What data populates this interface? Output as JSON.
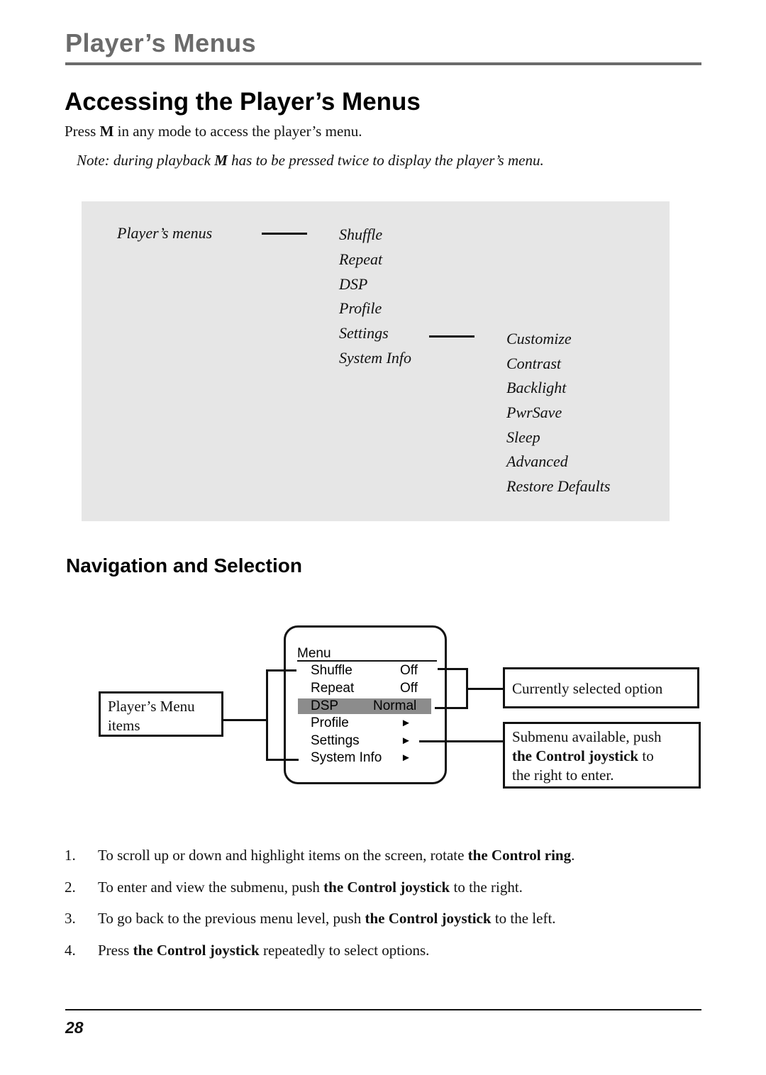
{
  "header": {
    "section_title": "Player’s Menus"
  },
  "accessing": {
    "title": "Accessing the Player’s Menus",
    "intro": {
      "pre": "Press ",
      "key": "M",
      "post": " in any mode to access the player’s menu."
    },
    "note": {
      "pre": "Note: during playback ",
      "key": "M",
      "post": " has to be pressed twice to display the player’s menu."
    }
  },
  "menu_tree": {
    "root": "Player’s menus",
    "level1": [
      "Shuffle",
      "Repeat",
      "DSP",
      "Profile",
      "Settings",
      "System Info"
    ],
    "settings_children": [
      "Customize",
      "Contrast",
      "Backlight",
      "PwrSave",
      "Sleep",
      "Advanced",
      "Restore Defaults"
    ]
  },
  "navigation": {
    "title": "Navigation and Selection",
    "screen": {
      "heading": "Menu",
      "rows": [
        {
          "label": "Shuffle",
          "value": "Off",
          "highlighted": false
        },
        {
          "label": "Repeat",
          "value": "Off",
          "highlighted": false
        },
        {
          "label": "DSP",
          "value": "Normal",
          "highlighted": true
        },
        {
          "label": "Profile",
          "value": "►",
          "highlighted": false
        },
        {
          "label": "Settings",
          "value": "►",
          "highlighted": false
        },
        {
          "label": "System Info",
          "value": "►",
          "highlighted": false
        }
      ]
    },
    "callouts": {
      "menu_items": {
        "line1": "Player’s Menu",
        "line2": "items"
      },
      "selected": "Currently selected option",
      "submenu": {
        "line1": "Submenu available, push",
        "bold": "the Control joystick",
        "tail": " to",
        "line3": "the right to enter."
      }
    },
    "steps": [
      {
        "num": "1.",
        "pre": "To scroll up or down and highlight items on the screen, rotate ",
        "bold": "the Control ring",
        "post": "."
      },
      {
        "num": "2.",
        "pre": "To enter and view the submenu, push ",
        "bold": "the Control joystick",
        "post": " to the right."
      },
      {
        "num": "3.",
        "pre": "To go back to the previous menu level, push ",
        "bold": "the Control joystick",
        "post": " to the left."
      },
      {
        "num": "4.",
        "pre": "Press ",
        "bold": "the Control joystick",
        "post": " repeatedly to select options."
      }
    ]
  },
  "footer": {
    "page_number": "28"
  },
  "colors": {
    "header_grey": "#6b6b6b",
    "panel_grey": "#e6e6e6",
    "highlight_grey": "#8c8c8c"
  }
}
